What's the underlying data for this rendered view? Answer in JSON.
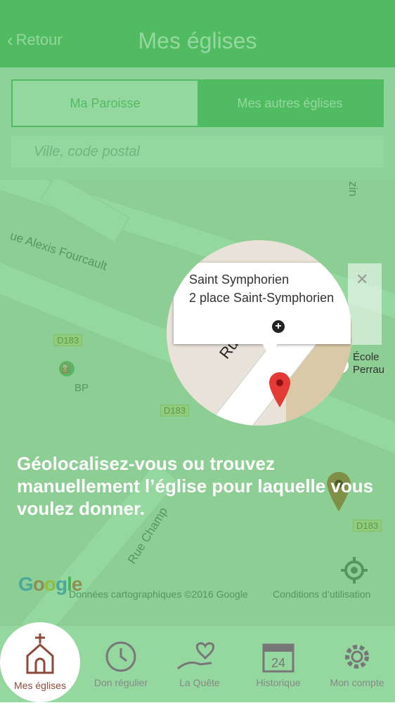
{
  "header": {
    "back_label": "Retour",
    "title": "Mes églises"
  },
  "segment": {
    "tab_a": "Ma Paroisse",
    "tab_b": "Mes autres églises"
  },
  "search": {
    "placeholder": "Ville, code postal"
  },
  "map": {
    "street_1": "ue Alexis Fourcault",
    "street_2": "Rue Champ",
    "street_3": "zin",
    "road_tags": [
      "D183",
      "D183",
      "D183"
    ],
    "poi_bp": "BP",
    "ecole": "École\nPerrau",
    "attribution": "Données cartographiques ©2016 Google",
    "terms": "Conditions d’utilisation"
  },
  "popup": {
    "name": "Saint Symphorien",
    "address": "2 place Saint-Symphorien",
    "street_label": "Rue Saint-"
  },
  "message": "Géolocalisez-vous ou trouvez manuellement l’église pour laquelle vous voulez donner.",
  "tabs": [
    {
      "label": "Mes églises",
      "icon": "church-icon"
    },
    {
      "label": "Don régulier",
      "icon": "clock-icon"
    },
    {
      "label": "La Quête",
      "icon": "heart-hand-icon"
    },
    {
      "label": "Historique",
      "icon": "calendar-icon",
      "day": "24"
    },
    {
      "label": "Mon compte",
      "icon": "gear-icon"
    }
  ],
  "colors": {
    "primary": "#4fb560",
    "accent": "#8b4a3a",
    "pin": "#e53935"
  }
}
